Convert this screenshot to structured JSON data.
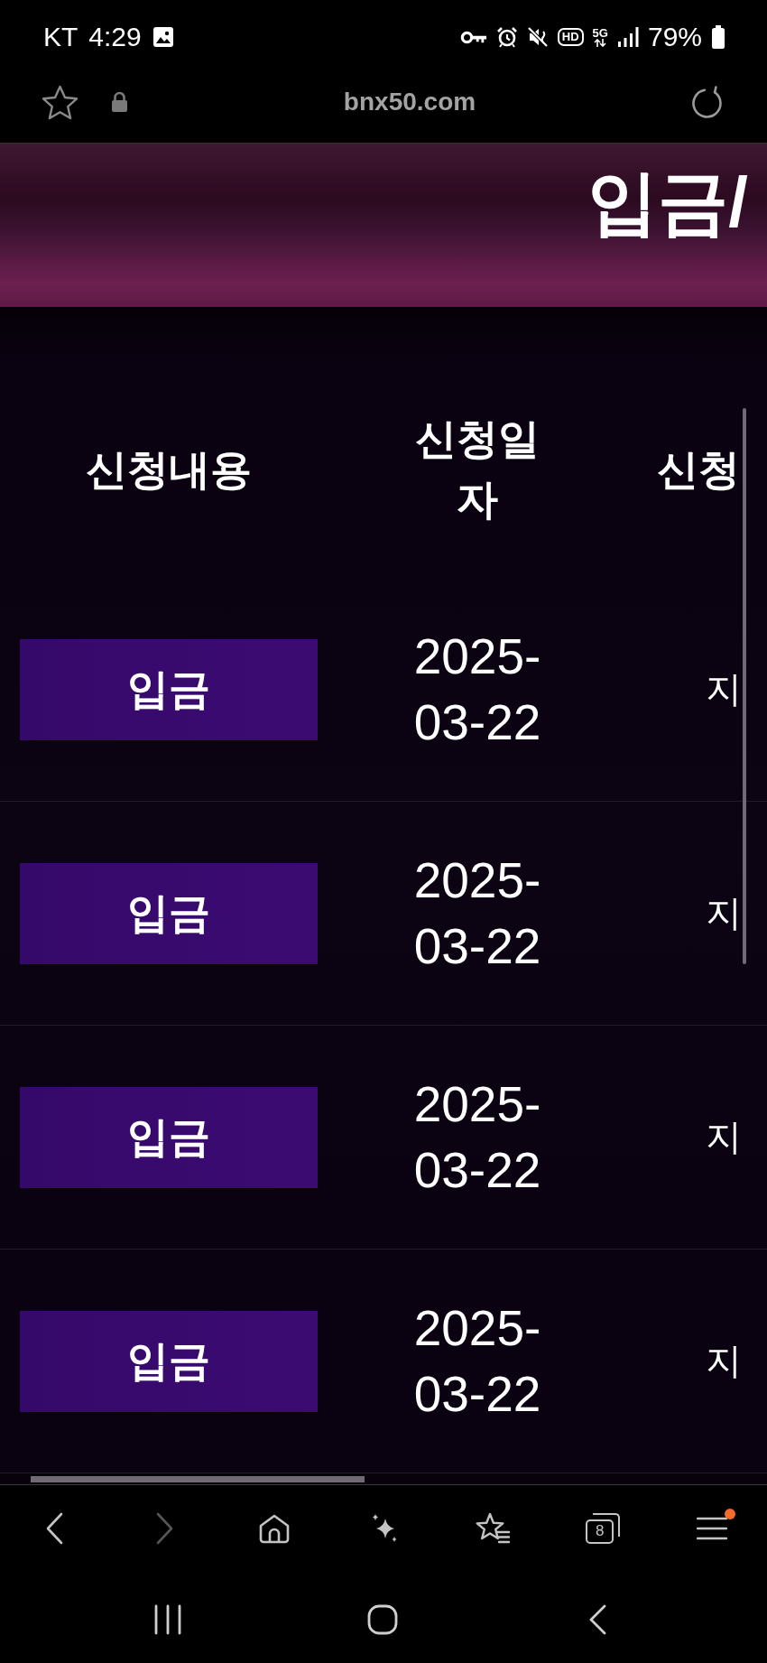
{
  "status_bar": {
    "carrier": "KT",
    "time": "4:29",
    "hd_label": "HD",
    "network_label": "5G",
    "battery": "79%"
  },
  "address_bar": {
    "url": "bnx50.com"
  },
  "banner": {
    "title": "입금/"
  },
  "table": {
    "columns": [
      "신청내용",
      "신청일자",
      "신청"
    ],
    "rows": [
      {
        "type": "입금",
        "date": "2025-03-22",
        "column_3": "지"
      },
      {
        "type": "입금",
        "date": "2025-03-22",
        "column_3": "지"
      },
      {
        "type": "입금",
        "date": "2025-03-22",
        "column_3": "지"
      },
      {
        "type": "입금",
        "date": "2025-03-22",
        "column_3": "지"
      }
    ]
  },
  "toolbar": {
    "items": [
      {
        "kind": "back",
        "disabled": false,
        "notification": false
      },
      {
        "kind": "forward",
        "disabled": true,
        "notification": false
      },
      {
        "kind": "home",
        "disabled": false,
        "notification": false
      },
      {
        "kind": "assistant",
        "disabled": false,
        "notification": false
      },
      {
        "kind": "bookmarks",
        "disabled": false,
        "notification": false
      },
      {
        "kind": "tabs",
        "count": "8",
        "disabled": false,
        "notification": false
      },
      {
        "kind": "menu",
        "disabled": false,
        "notification": true
      }
    ]
  },
  "system_nav": {
    "items": [
      {
        "kind": "recents"
      },
      {
        "kind": "home"
      },
      {
        "kind": "back"
      }
    ]
  }
}
